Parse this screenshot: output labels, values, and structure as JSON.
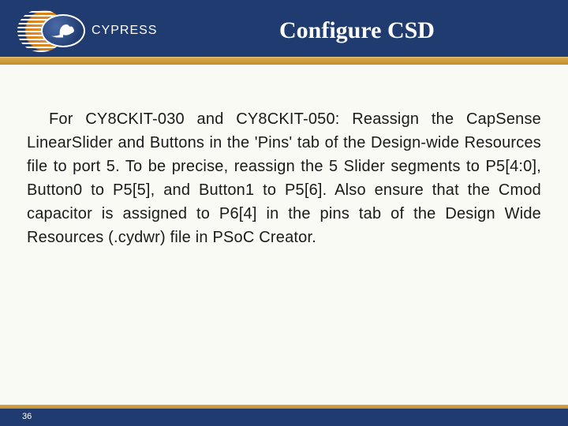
{
  "header": {
    "brand": "CYPRESS",
    "title": "Configure CSD"
  },
  "body": {
    "paragraph": "For CY8CKIT-030 and CY8CKIT-050: Reassign the CapSense LinearSlider and Buttons in the 'Pins' tab of the Design-wide Resources file to port 5. To be precise, reassign the 5 Slider segments to P5[4:0], Button0 to P5[5], and Button1 to P5[6]. Also ensure that the Cmod capacitor is assigned to P6[4] in the pins tab of the Design Wide Resources (.cydwr) file in PSoC Creator."
  },
  "footer": {
    "page_number": "36"
  }
}
